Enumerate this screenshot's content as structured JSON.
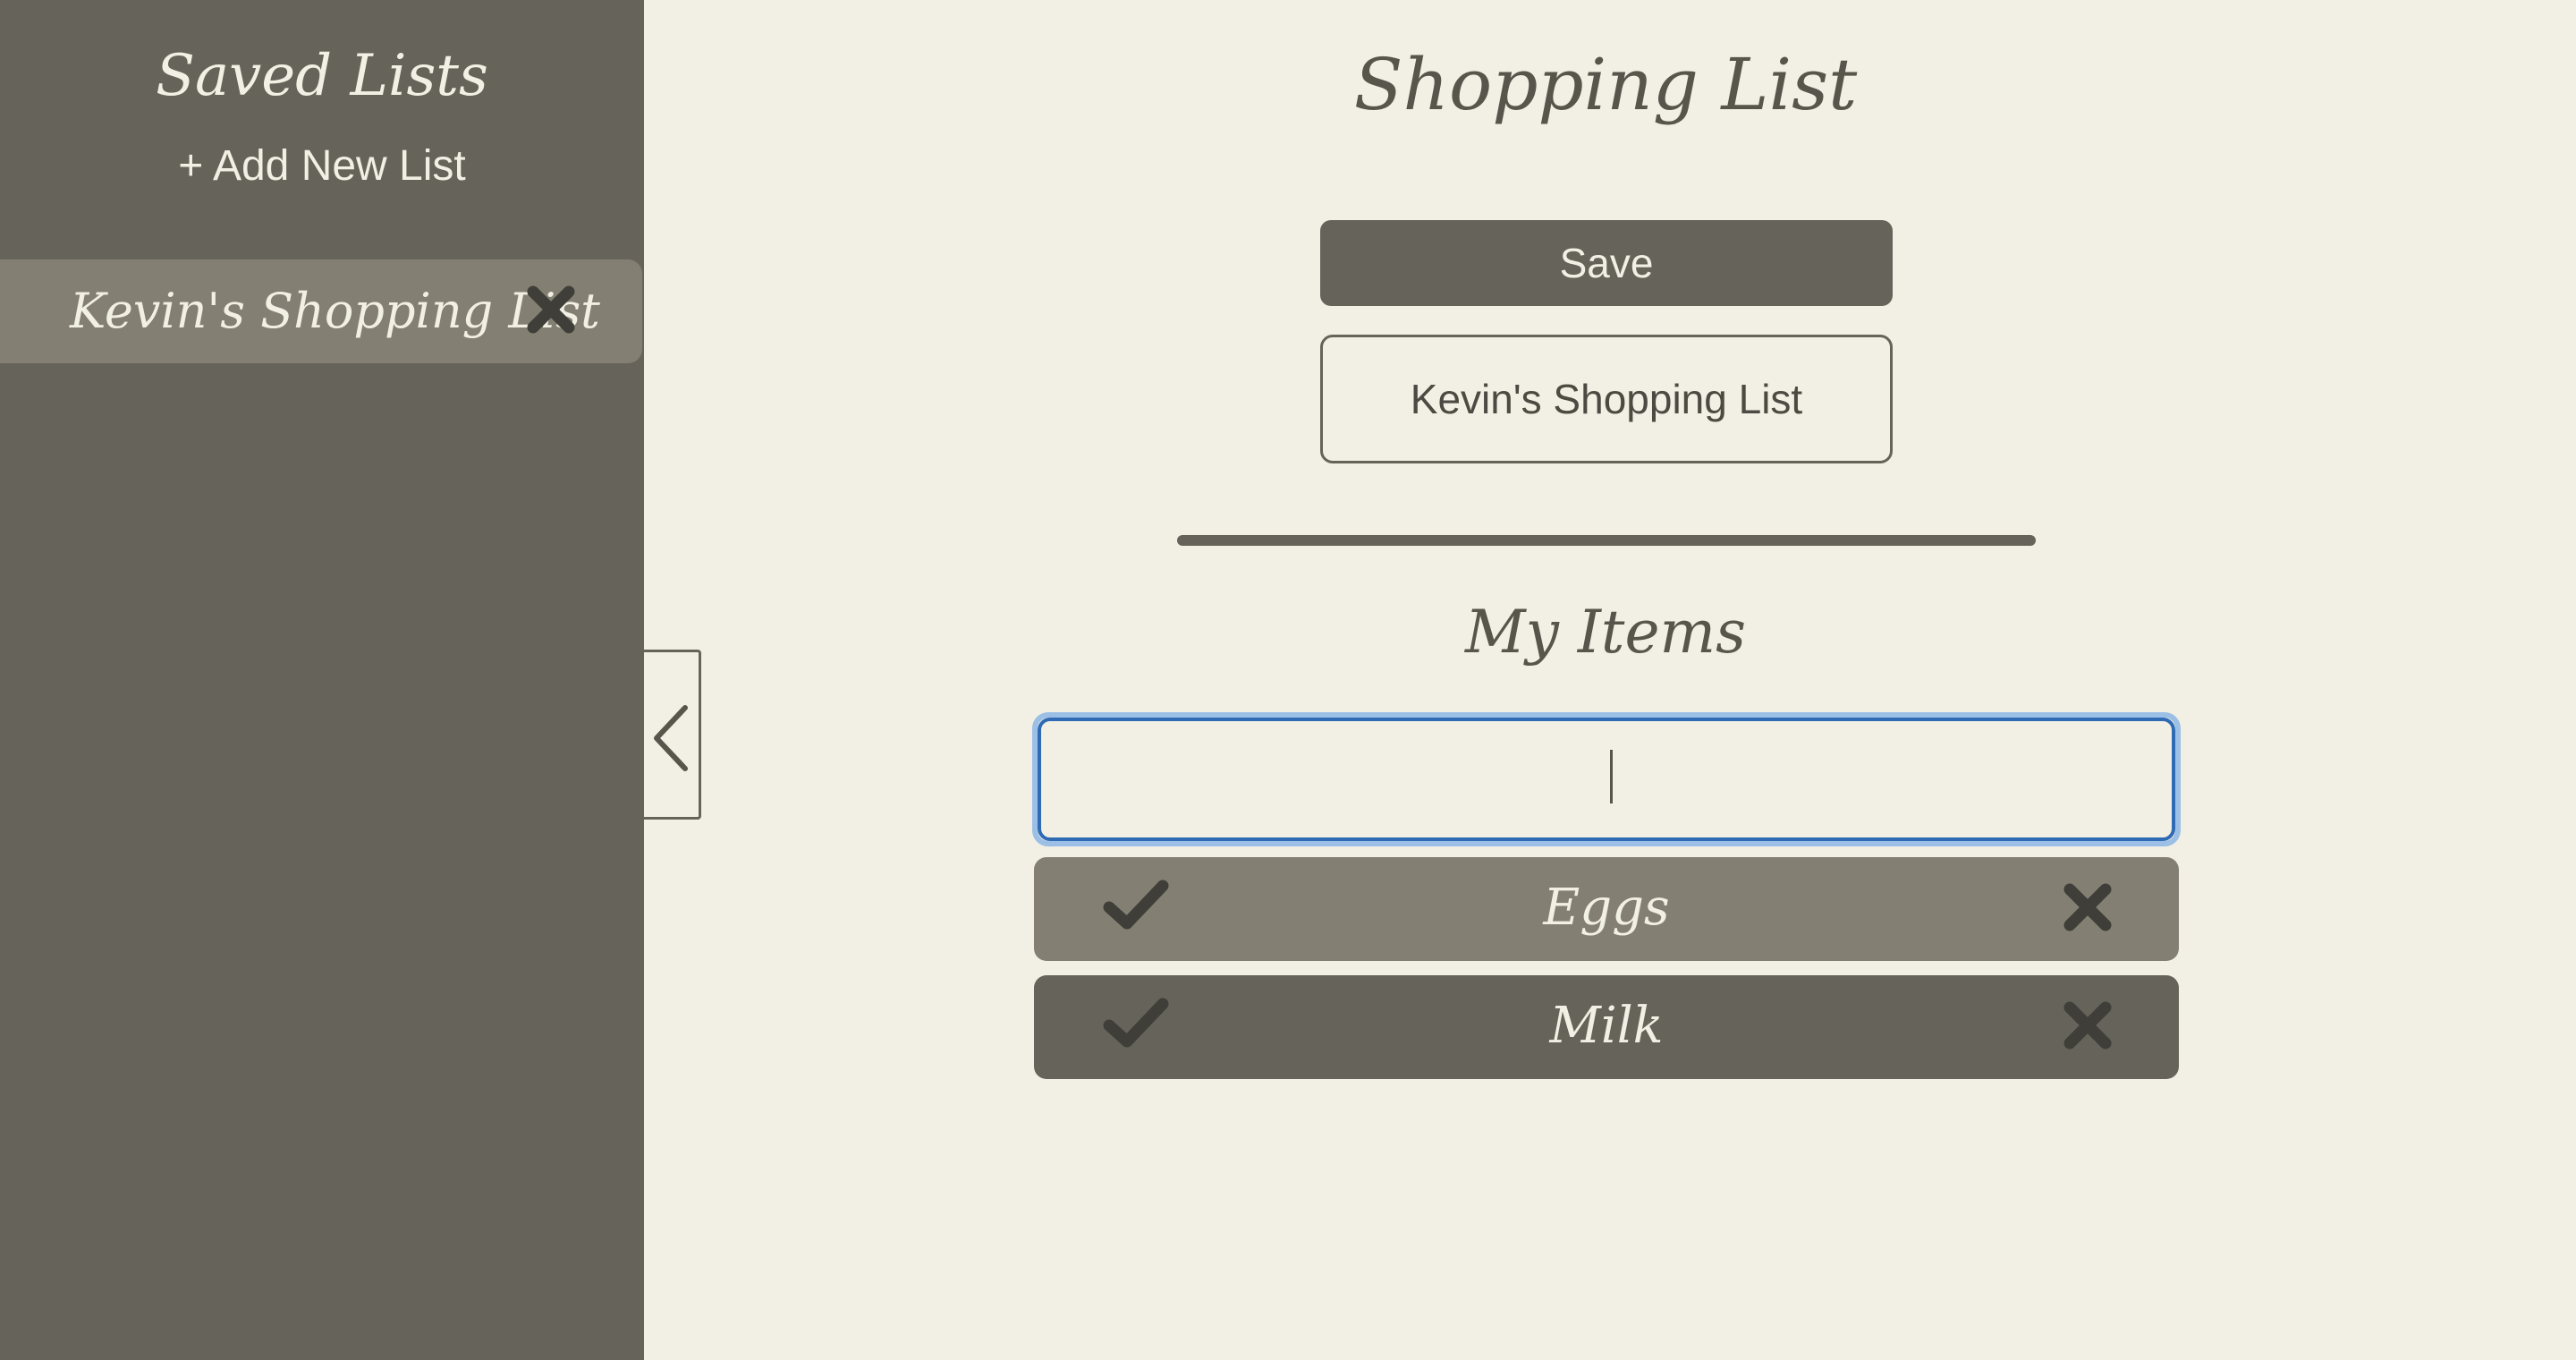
{
  "sidebar": {
    "title": "Saved Lists",
    "add_new_label": "+ Add New List",
    "lists": [
      {
        "name": "Kevin's Shopping List",
        "delete_icon": "close-x-icon"
      }
    ],
    "bg_color": "#66645a",
    "item_color": "#838073"
  },
  "toggle": {
    "icon": "chevron-left-icon"
  },
  "main": {
    "title": "Shopping List",
    "save_label": "Save",
    "list_name_value": "Kevin's Shopping List",
    "items_title": "My Items",
    "new_item_value": "",
    "items": [
      {
        "label": "Eggs",
        "check_icon": "checkmark-icon",
        "delete_icon": "close-x-icon",
        "color": "#838073"
      },
      {
        "label": "Milk",
        "check_icon": "checkmark-icon",
        "delete_icon": "close-x-icon",
        "color": "#66645a"
      }
    ]
  },
  "colors": {
    "background": "#f2f0e4",
    "text_light": "#f2f0e4",
    "text_dark": "#57554c",
    "icon_dark": "#3f3e38",
    "focus_ring": "#2f6bb5"
  }
}
